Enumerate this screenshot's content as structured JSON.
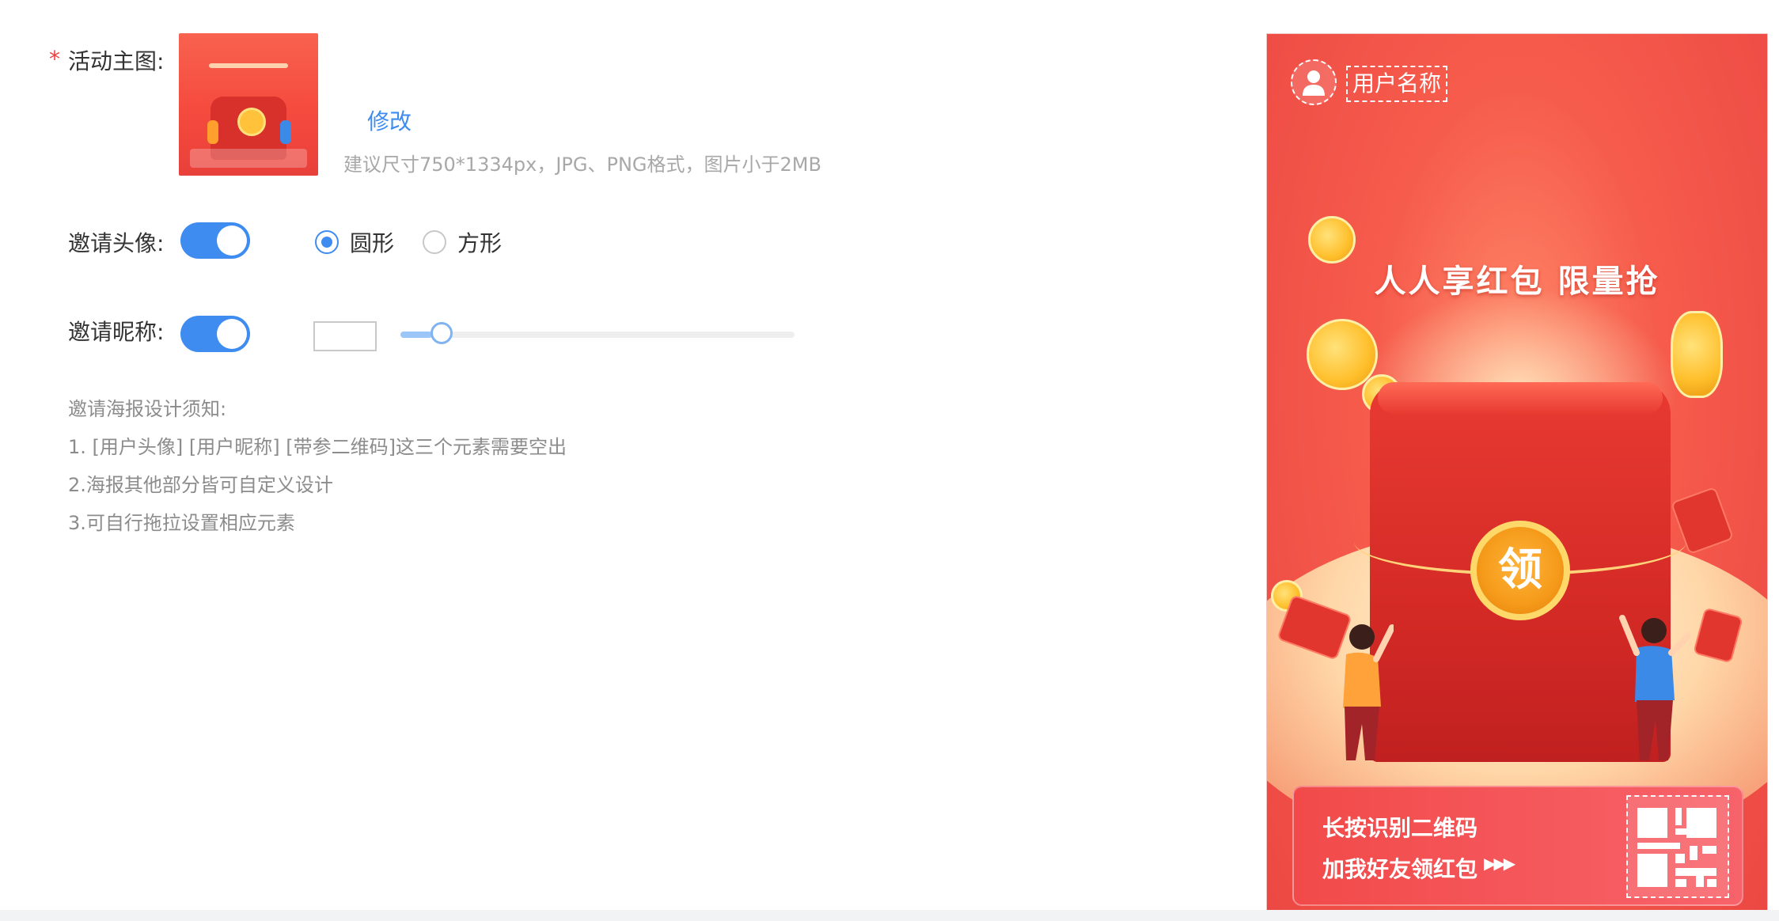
{
  "form": {
    "main_image": {
      "required_mark": "*",
      "label": "活动主图:",
      "modify_label": "修改",
      "hint": "建议尺寸750*1334px，JPG、PNG格式，图片小于2MB"
    },
    "invite_avatar": {
      "label": "邀请头像:",
      "enabled": true,
      "shape_options": [
        {
          "label": "圆形",
          "checked": true
        },
        {
          "label": "方形",
          "checked": false
        }
      ]
    },
    "invite_nickname": {
      "label": "邀请昵称:",
      "enabled": true,
      "font_size_slider_value": 0.08
    },
    "notes": [
      "邀请海报设计须知:",
      "1. [用户头像] [用户昵称] [带参二维码]这三个元素需要空出",
      "2.海报其他部分皆可自定义设计",
      "3.可自行拖拉设置相应元素"
    ]
  },
  "poster": {
    "username": "用户名称",
    "headline": "人人享红包 限量抢",
    "coin_char": "领",
    "footer_line1": "长按识别二维码",
    "footer_line2": "加我好友领红包",
    "arrows": "▶▶▶"
  },
  "colors": {
    "accent": "#3f8cf0",
    "poster_red": "#ec4843",
    "required": "#f04040"
  }
}
